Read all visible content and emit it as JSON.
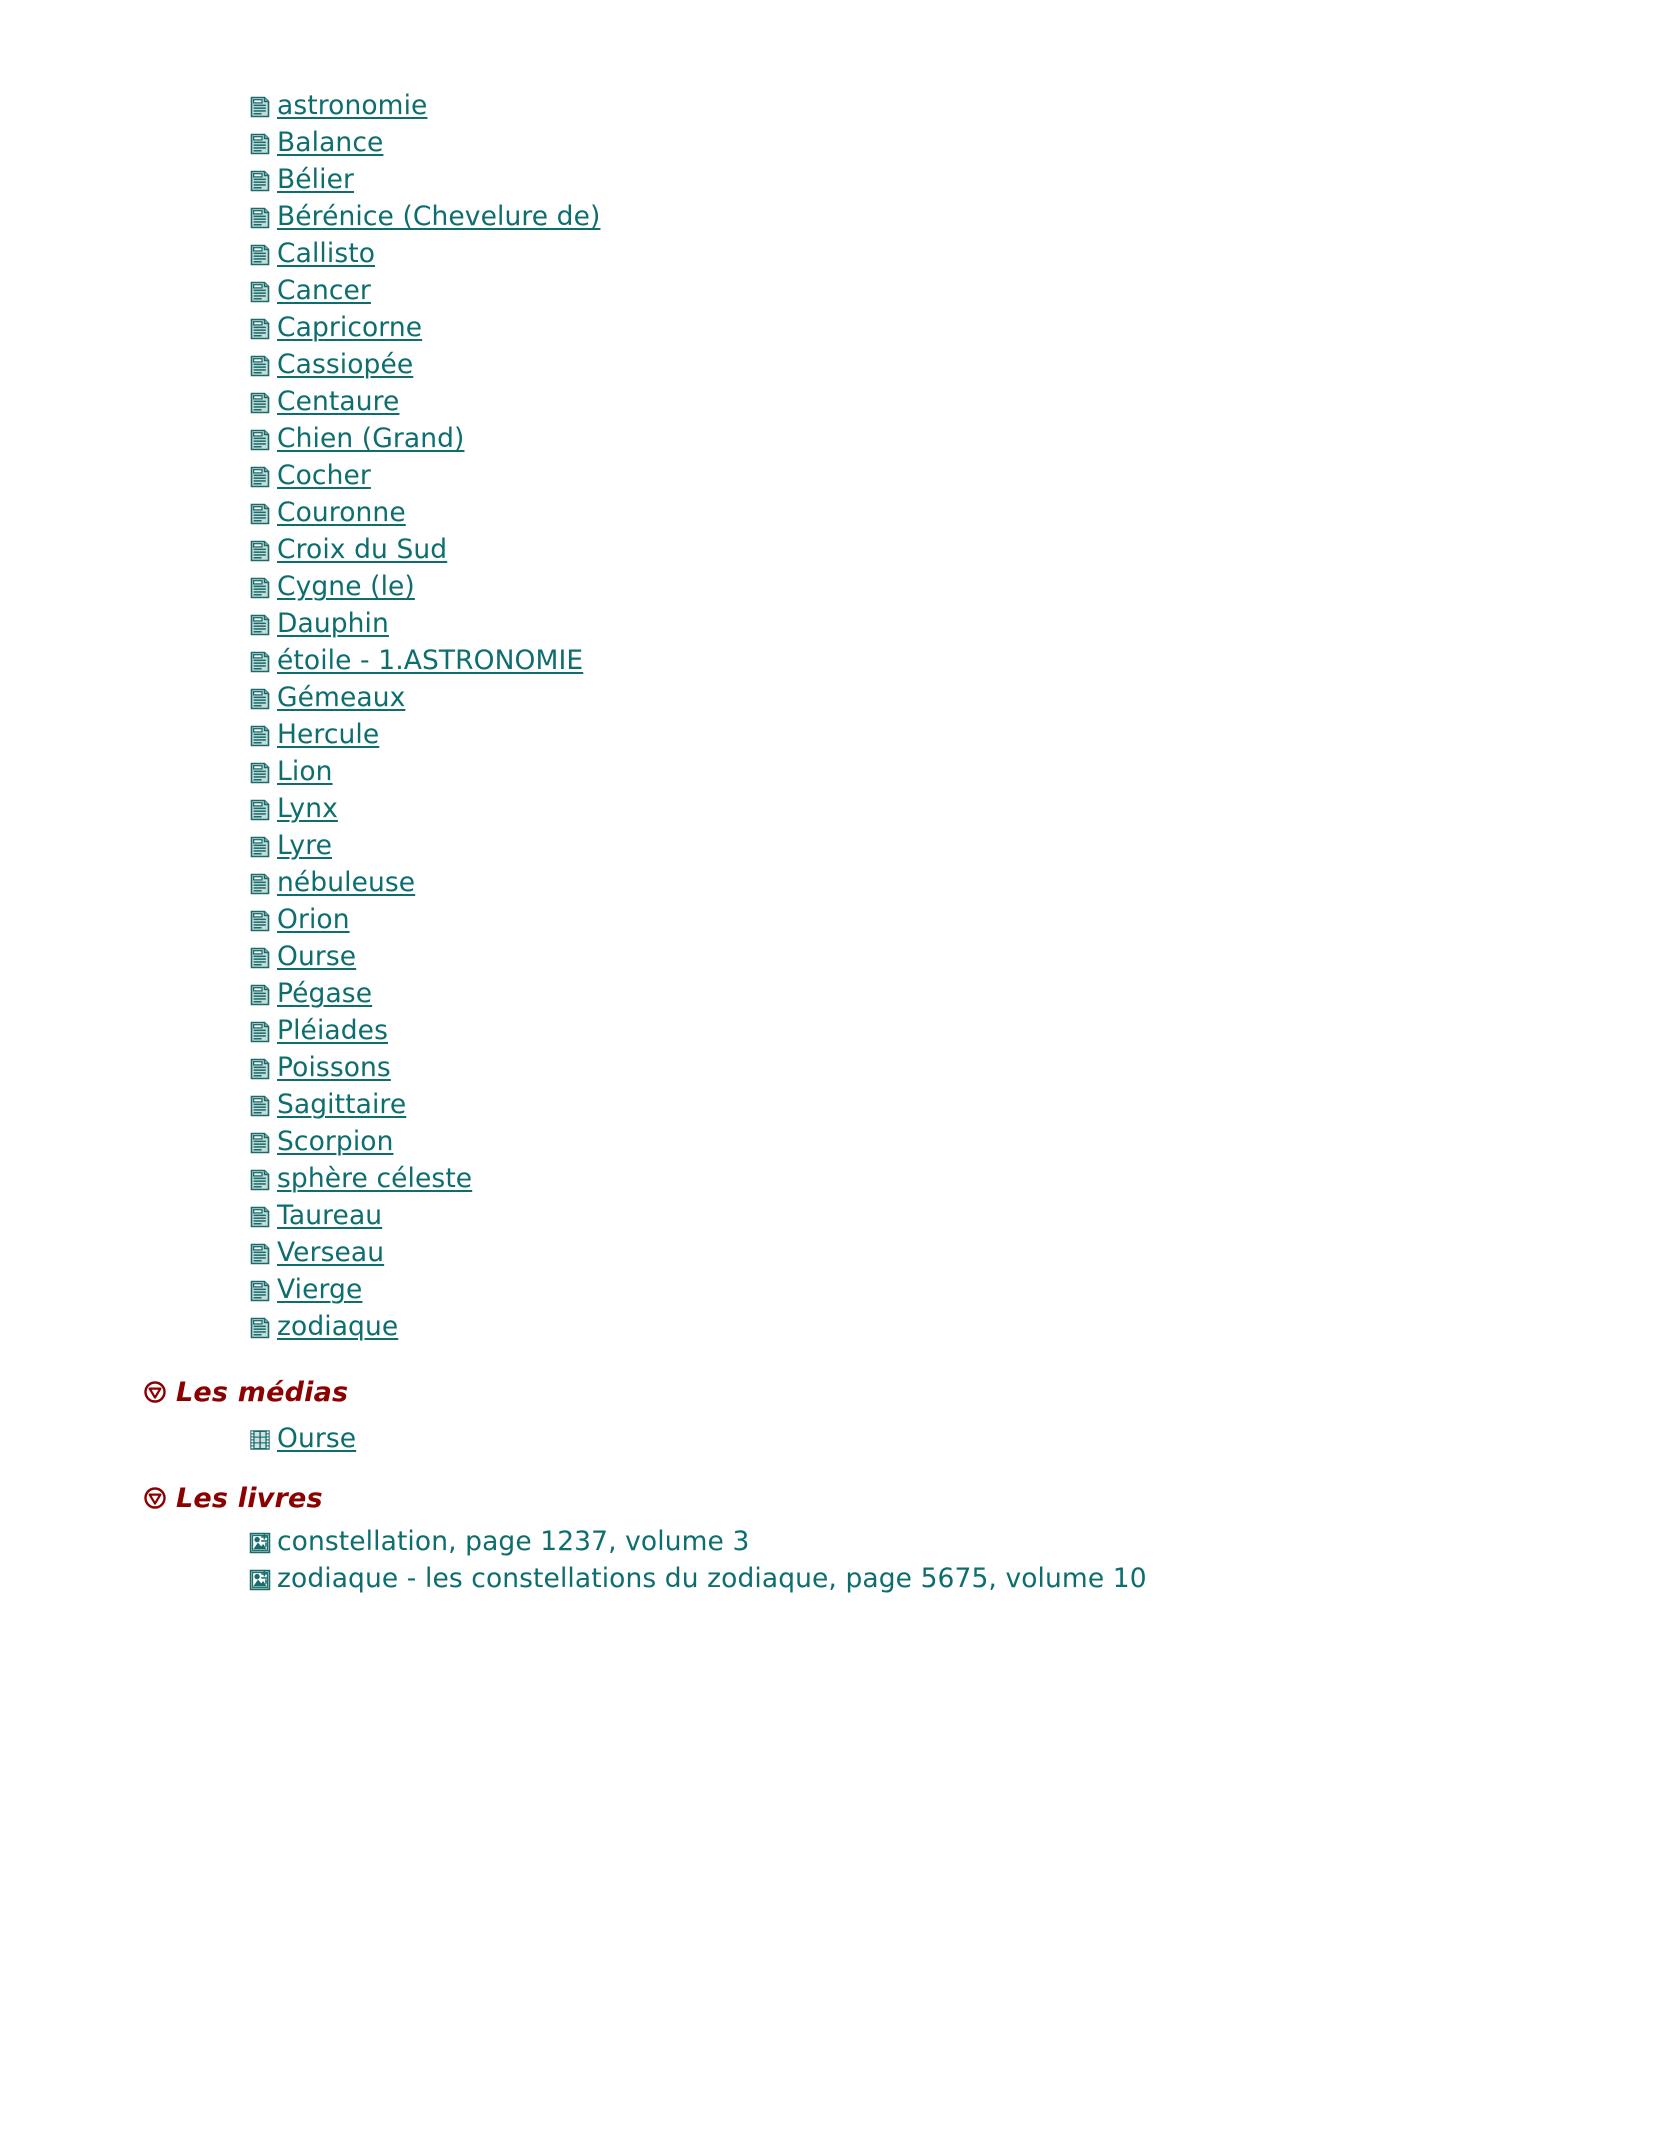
{
  "colors": {
    "link": "#0e6e6e",
    "heading": "#8b0000",
    "background": "#ffffff",
    "icon_fill": "#bcd8d4",
    "icon_stroke": "#1a6b6b"
  },
  "articles": {
    "icon_name": "document-icon",
    "items": [
      {
        "label": "astronomie"
      },
      {
        "label": "Balance"
      },
      {
        "label": "Bélier"
      },
      {
        "label": "Bérénice (Chevelure de)"
      },
      {
        "label": "Callisto"
      },
      {
        "label": "Cancer"
      },
      {
        "label": "Capricorne"
      },
      {
        "label": "Cassiopée"
      },
      {
        "label": "Centaure"
      },
      {
        "label": "Chien (Grand)"
      },
      {
        "label": "Cocher"
      },
      {
        "label": "Couronne"
      },
      {
        "label": "Croix du Sud"
      },
      {
        "label": "Cygne (le)"
      },
      {
        "label": "Dauphin"
      },
      {
        "label": "étoile - 1.ASTRONOMIE"
      },
      {
        "label": "Gémeaux"
      },
      {
        "label": "Hercule"
      },
      {
        "label": "Lion"
      },
      {
        "label": "Lynx"
      },
      {
        "label": "Lyre"
      },
      {
        "label": "nébuleuse"
      },
      {
        "label": "Orion"
      },
      {
        "label": "Ourse"
      },
      {
        "label": "Pégase"
      },
      {
        "label": "Pléiades"
      },
      {
        "label": "Poissons"
      },
      {
        "label": "Sagittaire"
      },
      {
        "label": "Scorpion"
      },
      {
        "label": "sphère céleste"
      },
      {
        "label": "Taureau"
      },
      {
        "label": "Verseau"
      },
      {
        "label": "Vierge"
      },
      {
        "label": "zodiaque"
      }
    ]
  },
  "medias": {
    "heading": "Les médias",
    "bullet_icon": "circle-triangle-bullet-icon",
    "icon_name": "film-strip-icon",
    "items": [
      {
        "label": "Ourse"
      }
    ]
  },
  "livres": {
    "heading": "Les livres",
    "bullet_icon": "circle-triangle-bullet-icon",
    "icon_name": "book-image-icon",
    "items": [
      {
        "label": "constellation, page 1237, volume 3"
      },
      {
        "label": "zodiaque - les constellations du zodiaque, page 5675, volume 10"
      }
    ]
  }
}
